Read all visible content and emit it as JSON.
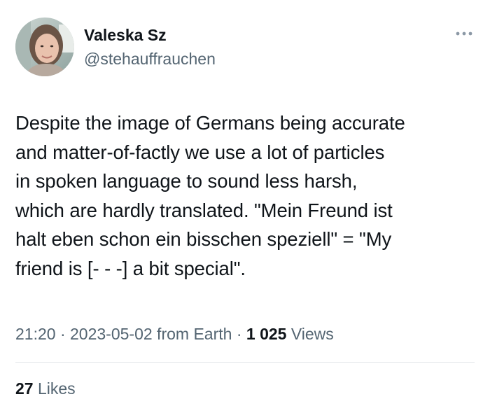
{
  "author": {
    "name": "Valeska Sz",
    "handle": "@stehauffrauchen",
    "avatar_icon": "profile-photo"
  },
  "more_icon": "more-options-icon",
  "tweet": {
    "lines": [
      "Despite the image of Germans being accurate",
      "and matter-of-factly we use a lot of particles",
      "in spoken language to sound less harsh,",
      "which are hardly translated. \"Mein Freund ist",
      "halt eben schon ein bisschen speziell\" = \"My",
      "friend is [- - -] a bit special\"."
    ]
  },
  "meta": {
    "time": "21:20",
    "separator": " · ",
    "date": "2023-05-02",
    "source": " from Earth",
    "views_count": "1 025",
    "views_label": " Views"
  },
  "likes": {
    "count": "27",
    "label": " Likes"
  },
  "colors": {
    "text": "#0f1419",
    "secondary": "#536471",
    "divider": "#e4e7ea"
  }
}
